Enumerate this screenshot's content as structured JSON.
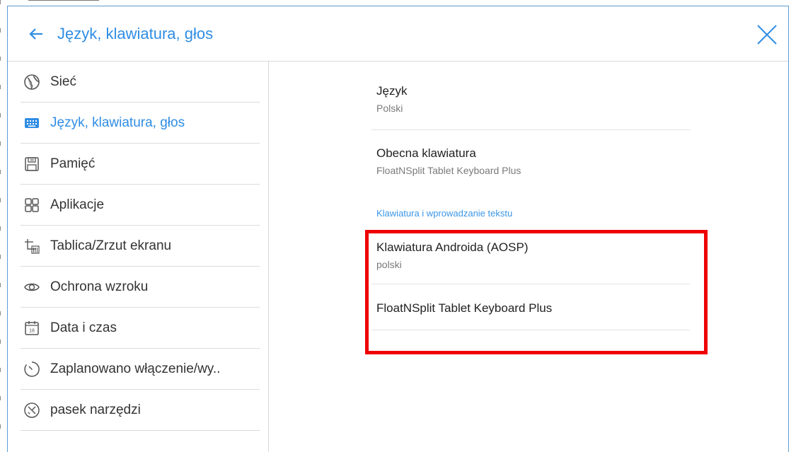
{
  "header": {
    "title": "Język, klawiatura, głos"
  },
  "sidebar": {
    "items": [
      {
        "label": "Sieć",
        "icon": "globe-icon"
      },
      {
        "label": "Język, klawiatura, głos",
        "icon": "keyboard-icon",
        "active": true
      },
      {
        "label": "Pamięć",
        "icon": "save-icon"
      },
      {
        "label": "Aplikacje",
        "icon": "apps-grid-icon"
      },
      {
        "label": "Tablica/Zrzut ekranu",
        "icon": "screenshot-icon"
      },
      {
        "label": "Ochrona wzroku",
        "icon": "eye-icon"
      },
      {
        "label": "Data i czas",
        "icon": "calendar-icon"
      },
      {
        "label": "Zaplanowano włączenie/wy..",
        "icon": "timer-icon"
      },
      {
        "label": "pasek narzędzi",
        "icon": "toolbar-icon"
      }
    ],
    "calendar_day": "18"
  },
  "main": {
    "language": {
      "title": "Język",
      "value": "Polski"
    },
    "current_keyboard": {
      "title": "Obecna klawiatura",
      "value": "FloatNSplit Tablet Keyboard Plus"
    },
    "section_header": "Klawiatura i wprowadzanie tekstu",
    "keyboards": [
      {
        "title": "Klawiatura Androida (AOSP)",
        "value": "polski"
      },
      {
        "title": "FloatNSplit Tablet Keyboard Plus"
      }
    ]
  },
  "colors": {
    "accent": "#2f8de4",
    "highlight": "#ee0000",
    "frame": "#5b9bd5"
  }
}
